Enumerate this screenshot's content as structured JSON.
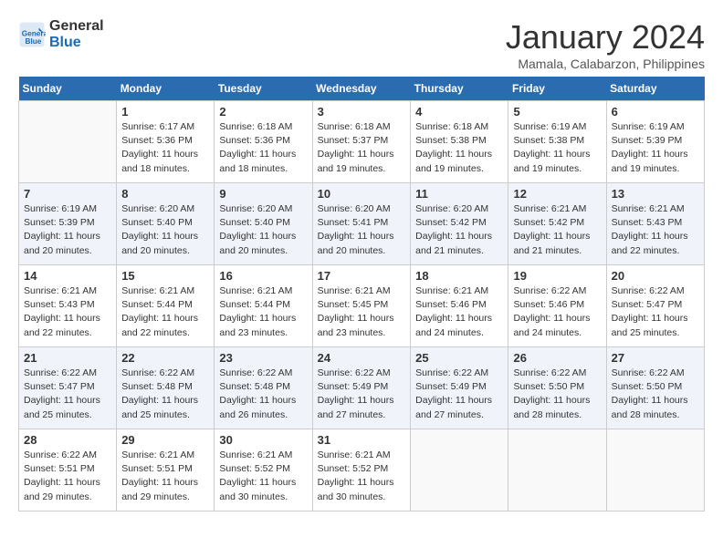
{
  "logo": {
    "line1": "General",
    "line2": "Blue"
  },
  "title": "January 2024",
  "subtitle": "Mamala, Calabarzon, Philippines",
  "days_header": [
    "Sunday",
    "Monday",
    "Tuesday",
    "Wednesday",
    "Thursday",
    "Friday",
    "Saturday"
  ],
  "weeks": [
    [
      {
        "day": "",
        "info": ""
      },
      {
        "day": "1",
        "info": "Sunrise: 6:17 AM\nSunset: 5:36 PM\nDaylight: 11 hours\nand 18 minutes."
      },
      {
        "day": "2",
        "info": "Sunrise: 6:18 AM\nSunset: 5:36 PM\nDaylight: 11 hours\nand 18 minutes."
      },
      {
        "day": "3",
        "info": "Sunrise: 6:18 AM\nSunset: 5:37 PM\nDaylight: 11 hours\nand 19 minutes."
      },
      {
        "day": "4",
        "info": "Sunrise: 6:18 AM\nSunset: 5:38 PM\nDaylight: 11 hours\nand 19 minutes."
      },
      {
        "day": "5",
        "info": "Sunrise: 6:19 AM\nSunset: 5:38 PM\nDaylight: 11 hours\nand 19 minutes."
      },
      {
        "day": "6",
        "info": "Sunrise: 6:19 AM\nSunset: 5:39 PM\nDaylight: 11 hours\nand 19 minutes."
      }
    ],
    [
      {
        "day": "7",
        "info": "Sunrise: 6:19 AM\nSunset: 5:39 PM\nDaylight: 11 hours\nand 20 minutes."
      },
      {
        "day": "8",
        "info": "Sunrise: 6:20 AM\nSunset: 5:40 PM\nDaylight: 11 hours\nand 20 minutes."
      },
      {
        "day": "9",
        "info": "Sunrise: 6:20 AM\nSunset: 5:40 PM\nDaylight: 11 hours\nand 20 minutes."
      },
      {
        "day": "10",
        "info": "Sunrise: 6:20 AM\nSunset: 5:41 PM\nDaylight: 11 hours\nand 20 minutes."
      },
      {
        "day": "11",
        "info": "Sunrise: 6:20 AM\nSunset: 5:42 PM\nDaylight: 11 hours\nand 21 minutes."
      },
      {
        "day": "12",
        "info": "Sunrise: 6:21 AM\nSunset: 5:42 PM\nDaylight: 11 hours\nand 21 minutes."
      },
      {
        "day": "13",
        "info": "Sunrise: 6:21 AM\nSunset: 5:43 PM\nDaylight: 11 hours\nand 22 minutes."
      }
    ],
    [
      {
        "day": "14",
        "info": "Sunrise: 6:21 AM\nSunset: 5:43 PM\nDaylight: 11 hours\nand 22 minutes."
      },
      {
        "day": "15",
        "info": "Sunrise: 6:21 AM\nSunset: 5:44 PM\nDaylight: 11 hours\nand 22 minutes."
      },
      {
        "day": "16",
        "info": "Sunrise: 6:21 AM\nSunset: 5:44 PM\nDaylight: 11 hours\nand 23 minutes."
      },
      {
        "day": "17",
        "info": "Sunrise: 6:21 AM\nSunset: 5:45 PM\nDaylight: 11 hours\nand 23 minutes."
      },
      {
        "day": "18",
        "info": "Sunrise: 6:21 AM\nSunset: 5:46 PM\nDaylight: 11 hours\nand 24 minutes."
      },
      {
        "day": "19",
        "info": "Sunrise: 6:22 AM\nSunset: 5:46 PM\nDaylight: 11 hours\nand 24 minutes."
      },
      {
        "day": "20",
        "info": "Sunrise: 6:22 AM\nSunset: 5:47 PM\nDaylight: 11 hours\nand 25 minutes."
      }
    ],
    [
      {
        "day": "21",
        "info": "Sunrise: 6:22 AM\nSunset: 5:47 PM\nDaylight: 11 hours\nand 25 minutes."
      },
      {
        "day": "22",
        "info": "Sunrise: 6:22 AM\nSunset: 5:48 PM\nDaylight: 11 hours\nand 25 minutes."
      },
      {
        "day": "23",
        "info": "Sunrise: 6:22 AM\nSunset: 5:48 PM\nDaylight: 11 hours\nand 26 minutes."
      },
      {
        "day": "24",
        "info": "Sunrise: 6:22 AM\nSunset: 5:49 PM\nDaylight: 11 hours\nand 27 minutes."
      },
      {
        "day": "25",
        "info": "Sunrise: 6:22 AM\nSunset: 5:49 PM\nDaylight: 11 hours\nand 27 minutes."
      },
      {
        "day": "26",
        "info": "Sunrise: 6:22 AM\nSunset: 5:50 PM\nDaylight: 11 hours\nand 28 minutes."
      },
      {
        "day": "27",
        "info": "Sunrise: 6:22 AM\nSunset: 5:50 PM\nDaylight: 11 hours\nand 28 minutes."
      }
    ],
    [
      {
        "day": "28",
        "info": "Sunrise: 6:22 AM\nSunset: 5:51 PM\nDaylight: 11 hours\nand 29 minutes."
      },
      {
        "day": "29",
        "info": "Sunrise: 6:21 AM\nSunset: 5:51 PM\nDaylight: 11 hours\nand 29 minutes."
      },
      {
        "day": "30",
        "info": "Sunrise: 6:21 AM\nSunset: 5:52 PM\nDaylight: 11 hours\nand 30 minutes."
      },
      {
        "day": "31",
        "info": "Sunrise: 6:21 AM\nSunset: 5:52 PM\nDaylight: 11 hours\nand 30 minutes."
      },
      {
        "day": "",
        "info": ""
      },
      {
        "day": "",
        "info": ""
      },
      {
        "day": "",
        "info": ""
      }
    ]
  ]
}
